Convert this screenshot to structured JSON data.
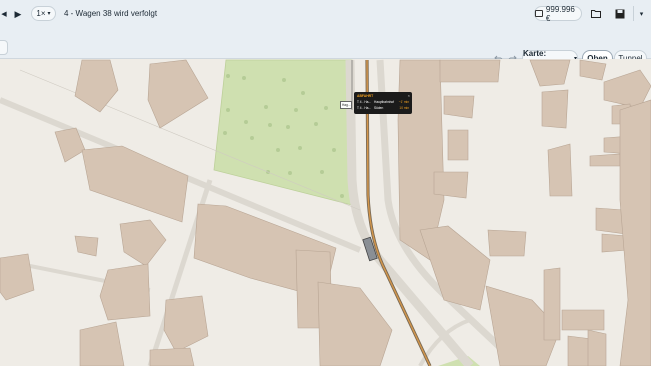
{
  "toolbar": {
    "prev_symbol": "◀",
    "play_symbol": "▶",
    "speed_label": "1×",
    "speed_caret": "▾",
    "title": "4 - Wagen 38 wird verfolgt",
    "money": "999.996 €",
    "money_icon": "wallet-icon",
    "open_icon": "folder-icon",
    "save_icon": "save-icon",
    "menu_caret": "▾"
  },
  "subtoolbar": {
    "left_button": "",
    "undo_icon": "undo-icon",
    "redo_icon": "redo-icon",
    "map_label": "Karte: Technik",
    "map_caret": "▾",
    "layer_top": "Oben",
    "layer_tunnel": "Tunnel"
  },
  "popup": {
    "header": "ABFAHRT",
    "rows": [
      {
        "line": "T 4 - Ha...",
        "dest": "Hauptbahnhof",
        "time": "~1' min"
      },
      {
        "line": "T 4 - Ha...",
        "dest": "Süden",
        "time": "10 min"
      }
    ],
    "close": "×"
  },
  "stop_marker": "Hag...",
  "colors": {
    "map_bg": "#efece6",
    "building": "#d6c4b3",
    "park": "#cfe0b0",
    "track": "#c98b3e",
    "toolbar": "#e8eef3"
  }
}
